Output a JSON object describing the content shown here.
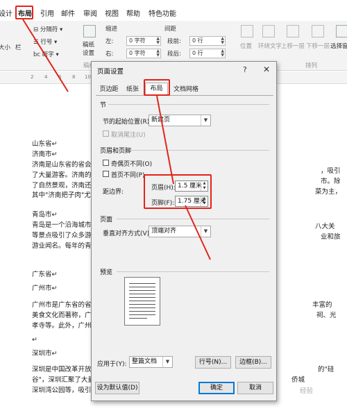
{
  "ribbon_tabs": [
    "设计",
    "布局",
    "引用",
    "邮件",
    "审阅",
    "视图",
    "帮助",
    "特色功能"
  ],
  "ribbon": {
    "page_setup": {
      "columns": "栏",
      "size": "大小",
      "breaks": "分隔符",
      "line_numbers": "行号",
      "hyphenation": "断字",
      "group_label_partial": "页"
    },
    "manuscript": {
      "label1": "稿纸",
      "label2": "设置",
      "group": "稿纸"
    },
    "indent": {
      "header": "缩进",
      "left_label": "左:",
      "left_value": "0 字符",
      "right_label": "右:",
      "right_value": "0 字符"
    },
    "spacing": {
      "header": "间距",
      "before_label": "段前:",
      "before_value": "0 行",
      "after_label": "段后:",
      "after_value": "0 行"
    },
    "arrange": {
      "position": "位置",
      "wrap": "环绕文字",
      "forward": "上移一层",
      "backward": "下移一层",
      "select_pane": "选择窗格",
      "group": "排列"
    }
  },
  "ruler": [
    "2",
    "4",
    "6",
    "8",
    "10",
    "12",
    "14",
    "16",
    "18",
    "20",
    "22",
    "24",
    "26",
    "28",
    "30",
    "32",
    "34",
    "36",
    "38",
    "40",
    "42",
    "44"
  ],
  "document": {
    "lines": [
      "山东省↵",
      "济南市↵",
      "济南是山东省的省会",
      "了大量游客。济南的",
      "了自然景观，济南还",
      "其中\"济南把子肉\"尤",
      "",
      "青岛市↵",
      "青岛是一个沿海城市",
      "等景点吸引了众多游",
      "游业闻名。每年的青",
      "",
      "广东省↵",
      "广州市↵",
      "广州市是广东省的省",
      "美食文化而著称，广",
      "孝寺等。此外，广州",
      "↵",
      "深圳市↵",
      "深圳是中国改革开放",
      "谷\"，深圳汇聚了大量",
      "深圳湾公园等，吸引"
    ],
    "right_fragments": [
      "，吸引",
      "市。除",
      "菜为主，",
      "八大关",
      "业和旅",
      "丰富的",
      "祠、光",
      "的\"硅",
      "侨城"
    ]
  },
  "dialog": {
    "title": "页面设置",
    "help": "?",
    "close": "✕",
    "tabs": [
      "页边距",
      "纸张",
      "布局",
      "文档网格"
    ],
    "selected_tab": "布局",
    "section": {
      "header": "节",
      "start_label": "节的起始位置(R):",
      "start_value": "新建页",
      "suppress_endnotes": "取消尾注(U)"
    },
    "headers_footers": {
      "header": "页眉和页脚",
      "odd_even": "奇偶页不同(O)",
      "first_page": "首页不同(P)",
      "from_edge": "距边界:",
      "header_label": "页眉(H):",
      "header_value": "1.5 厘米",
      "footer_label": "页脚(F):",
      "footer_value": "1.75 厘米"
    },
    "page": {
      "header": "页面",
      "valign_label": "垂直对齐方式(V):",
      "valign_value": "顶端对齐"
    },
    "preview": {
      "header": "预览"
    },
    "apply_to_label": "应用于(Y):",
    "apply_to_value": "整篇文档",
    "line_numbers_button": "行号(N)...",
    "borders_button": "边框(B)...",
    "set_default_button": "设为默认值(D)",
    "ok_button": "确定",
    "cancel_button": "取消"
  },
  "watermark": "经验",
  "accent": {
    "annotation_red": "#e2231a",
    "focus_blue": "#0078d7"
  }
}
